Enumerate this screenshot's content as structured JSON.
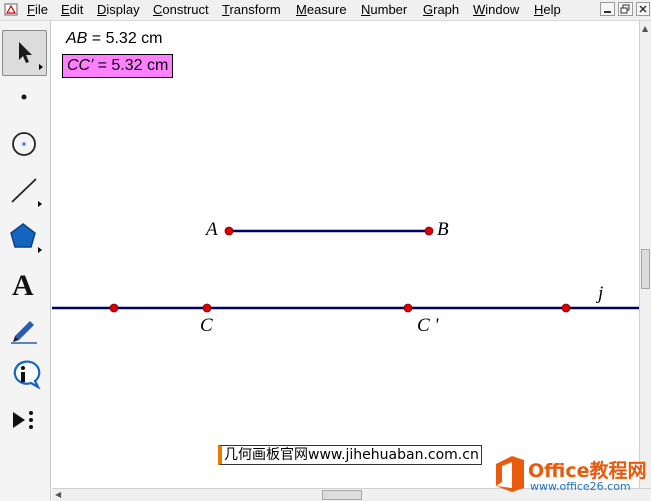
{
  "menu": {
    "items": [
      {
        "label": "File",
        "hotkey": "F",
        "rest": "ile"
      },
      {
        "label": "Edit",
        "hotkey": "E",
        "rest": "dit"
      },
      {
        "label": "Display",
        "hotkey": "D",
        "rest": "isplay"
      },
      {
        "label": "Construct",
        "hotkey": "C",
        "rest": "onstruct"
      },
      {
        "label": "Transform",
        "hotkey": "T",
        "rest": "ransform"
      },
      {
        "label": "Measure",
        "hotkey": "M",
        "rest": "easure"
      },
      {
        "label": "Number",
        "hotkey": "N",
        "rest": "umber"
      },
      {
        "label": "Graph",
        "hotkey": "G",
        "rest": "raph"
      },
      {
        "label": "Window",
        "hotkey": "W",
        "rest": "indow"
      },
      {
        "label": "Help",
        "hotkey": "H",
        "rest": "elp"
      }
    ],
    "window_buttons": [
      "minimize",
      "restore",
      "close"
    ]
  },
  "toolbox": {
    "tools": [
      {
        "name": "arrow-tool-icon",
        "selected": true
      },
      {
        "name": "point-tool-icon"
      },
      {
        "name": "compass-tool-icon"
      },
      {
        "name": "straightedge-tool-icon"
      },
      {
        "name": "polygon-tool-icon"
      },
      {
        "name": "text-tool-icon",
        "glyph": "A"
      },
      {
        "name": "marker-tool-icon"
      },
      {
        "name": "information-tool-icon"
      },
      {
        "name": "custom-tool-icon"
      }
    ]
  },
  "sketch": {
    "measurements": {
      "ab": {
        "name": "AB",
        "equals": " = ",
        "value": "5.32 cm"
      },
      "cc": {
        "name": "CC'",
        "equals": " = ",
        "value": "5.32 cm"
      }
    },
    "labels": {
      "A": "A",
      "B": "B",
      "C": "C",
      "Cprime": "C '",
      "j": "j"
    },
    "colors": {
      "line": "#000066",
      "point": "#dd0000",
      "highlight": "#ff80ff"
    }
  },
  "watermark": "几何画板官网www.jihehuaban.com.cn",
  "logo": {
    "main": "Office教程网",
    "sub": "www.office26.com"
  }
}
